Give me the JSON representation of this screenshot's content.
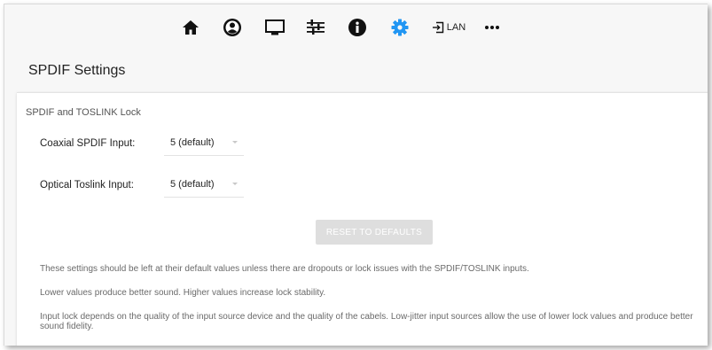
{
  "nav": {
    "icons": [
      "home-icon",
      "user-icon",
      "monitor-icon",
      "sliders-icon",
      "info-icon",
      "gear-icon",
      "input-icon",
      "more-icon"
    ],
    "lan_label": "LAN",
    "active_color": "#2196f3"
  },
  "page": {
    "title": "SPDIF Settings"
  },
  "card": {
    "section_title": "SPDIF and TOSLINK Lock",
    "coaxial": {
      "label": "Coaxial SPDIF Input:",
      "value": "5 (default)"
    },
    "optical": {
      "label": "Optical Toslink Input:",
      "value": "5 (default)"
    },
    "reset_label": "RESET TO DEFAULTS",
    "notes": [
      "These settings should be left at their default values unless there are dropouts or lock issues with the SPDIF/TOSLINK inputs.",
      "Lower values produce better sound. Higher values increase lock stability.",
      "Input lock depends on the quality of the input source device and the quality of the cabels. Low-jitter input sources allow the use of lower lock values and produce better sound fidelity."
    ]
  }
}
